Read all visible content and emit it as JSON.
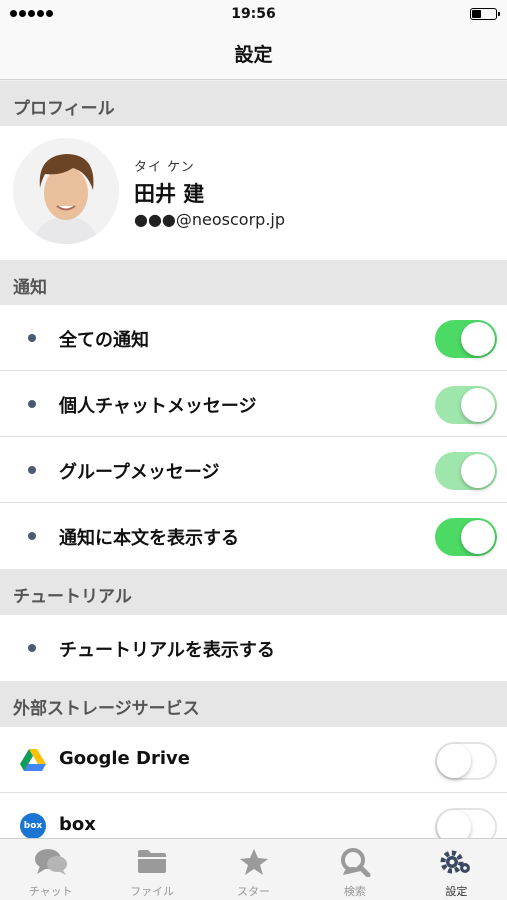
{
  "status_bar": {
    "time": "19:56",
    "battery_level": 0.35
  },
  "nav": {
    "title": "設定"
  },
  "profile_section": {
    "header": "プロフィール",
    "kana": "タイ ケン",
    "name": "田井 建",
    "email": "●●●@neoscorp.jp"
  },
  "notifications": {
    "header": "通知",
    "items": [
      {
        "label": "全ての通知",
        "toggle": "on"
      },
      {
        "label": "個人チャットメッセージ",
        "toggle": "on-disabled"
      },
      {
        "label": "グループメッセージ",
        "toggle": "on-disabled"
      },
      {
        "label": "通知に本文を表示する",
        "toggle": "on"
      }
    ]
  },
  "tutorial": {
    "header": "チュートリアル",
    "items": [
      {
        "label": "チュートリアルを表示する"
      }
    ]
  },
  "external_storage": {
    "header": "外部ストレージサービス",
    "items": [
      {
        "label": "Google Drive",
        "icon": "google-drive-icon",
        "toggle": "off"
      },
      {
        "label": "box",
        "icon": "box-icon",
        "icon_text": "box",
        "toggle": "off"
      }
    ]
  },
  "tab_bar": {
    "tabs": [
      {
        "label": "チャット",
        "icon": "chat-bubbles-icon"
      },
      {
        "label": "ファイル",
        "icon": "folder-icon"
      },
      {
        "label": "スター",
        "icon": "star-icon"
      },
      {
        "label": "検索",
        "icon": "search-icon"
      },
      {
        "label": "設定",
        "icon": "gear-icon",
        "active": true
      }
    ]
  },
  "colors": {
    "toggle_on": "#4cd964",
    "toggle_on_disabled": "#9fe6ad",
    "bullet": "#4a5a72",
    "section_bg": "#e6e6e6"
  }
}
